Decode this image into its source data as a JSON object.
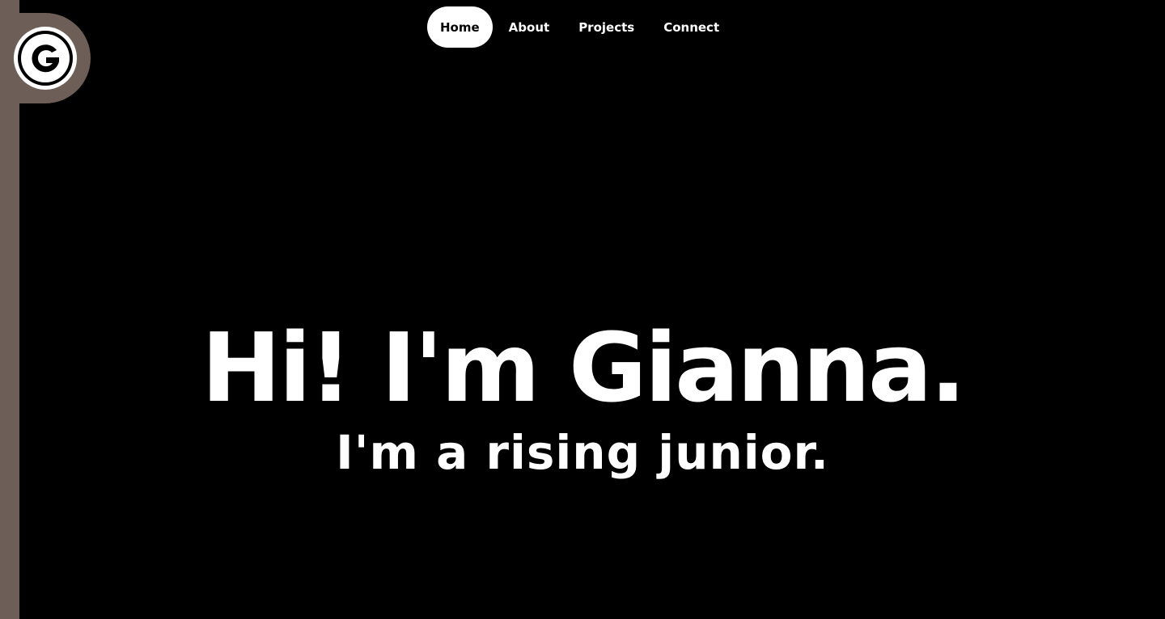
{
  "nav": {
    "items": [
      {
        "label": "Home",
        "active": true
      },
      {
        "label": "About",
        "active": false
      },
      {
        "label": "Projects",
        "active": false
      },
      {
        "label": "Connect",
        "active": false
      }
    ]
  },
  "logo": {
    "icon": "g-monogram-icon",
    "text": "G"
  },
  "hero": {
    "title": "Hi! I'm Gianna.",
    "subtitle": "I'm a rising junior."
  },
  "colors": {
    "background": "#000000",
    "accent": "#6d5f57",
    "text": "#ffffff"
  }
}
